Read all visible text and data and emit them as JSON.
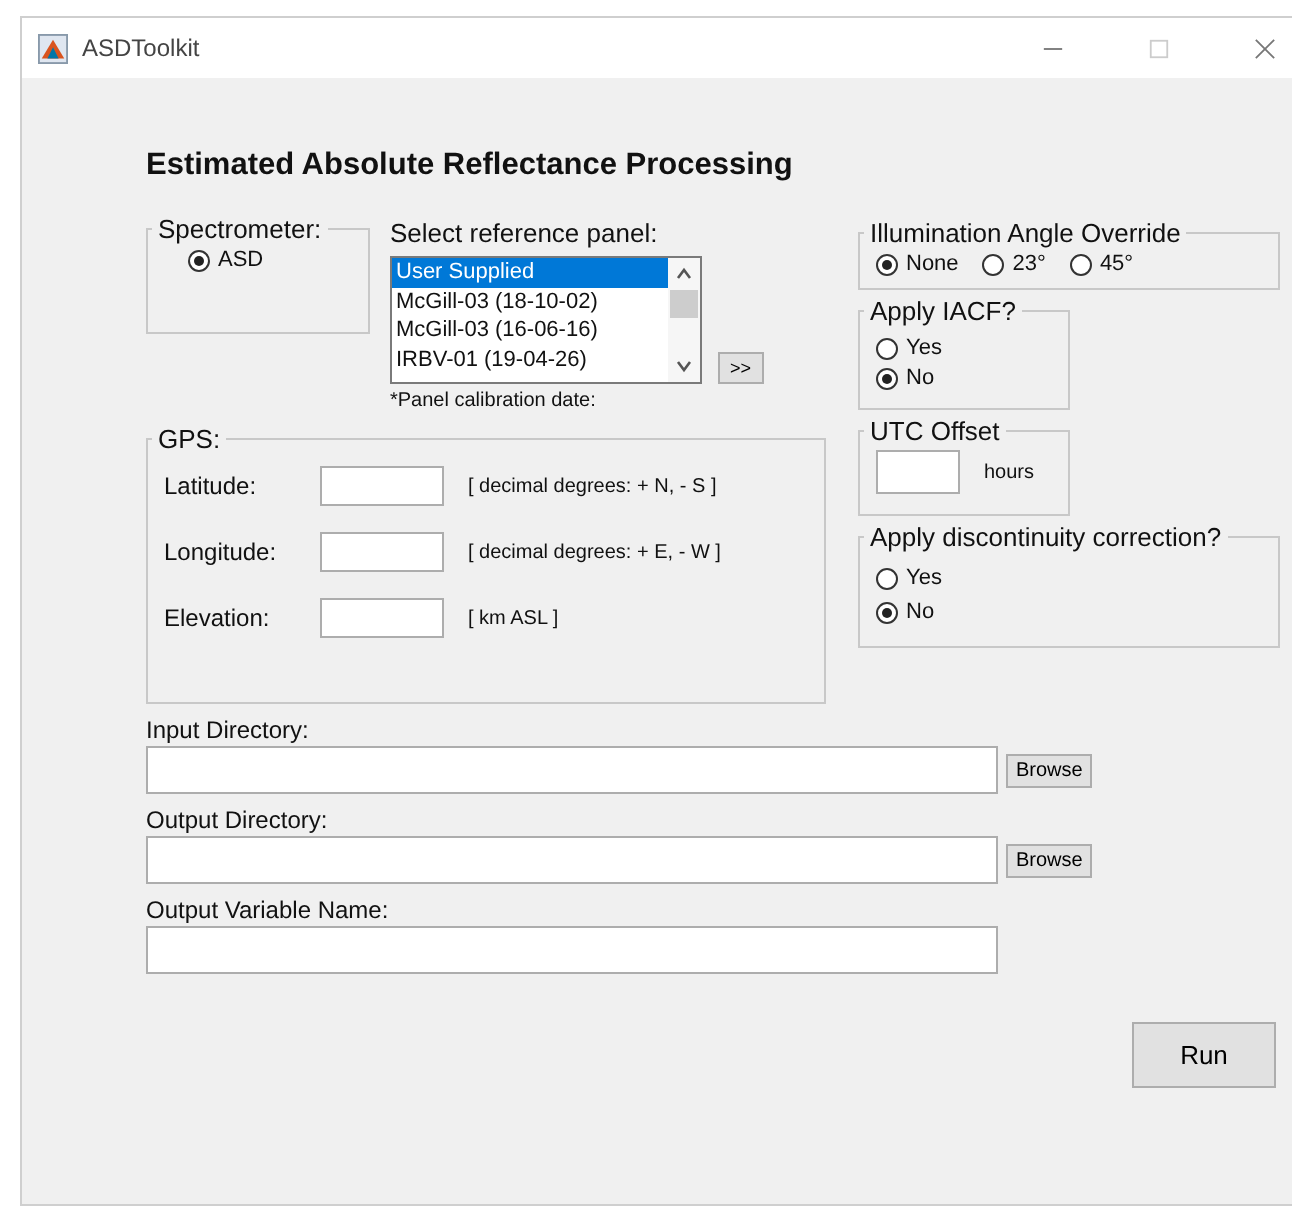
{
  "window": {
    "title": "ASDToolkit"
  },
  "heading": "Estimated Absolute Reflectance Processing",
  "spectrometer": {
    "label": "Spectrometer:",
    "options": [
      {
        "label": "ASD",
        "selected": true
      }
    ]
  },
  "reference_panel": {
    "label": "Select reference panel:",
    "items": [
      {
        "label": "User Supplied",
        "selected": true
      },
      {
        "label": "McGill-03 (18-10-02)",
        "selected": false
      },
      {
        "label": "McGill-03 (16-06-16)",
        "selected": false
      },
      {
        "label": "IRBV-01 (19-04-26)",
        "selected": false
      }
    ],
    "add_button": ">>",
    "note": "*Panel calibration date:"
  },
  "gps": {
    "label": "GPS:",
    "fields": [
      {
        "label": "Latitude:",
        "hint": "[ decimal degrees: + N, - S ]"
      },
      {
        "label": "Longitude:",
        "hint": "[ decimal degrees: + E, - W ]"
      },
      {
        "label": "Elevation:",
        "hint": "[ km ASL ]"
      }
    ]
  },
  "illumination": {
    "label": "Illumination Angle Override",
    "options": [
      {
        "label": "None",
        "selected": true
      },
      {
        "label": "23°",
        "selected": false
      },
      {
        "label": "45°",
        "selected": false
      }
    ]
  },
  "iacf": {
    "label": "Apply IACF?",
    "options": [
      {
        "label": "Yes",
        "selected": false
      },
      {
        "label": "No",
        "selected": true
      }
    ]
  },
  "utc": {
    "label": "UTC Offset",
    "unit": "hours"
  },
  "discontinuity": {
    "label": "Apply discontinuity correction?",
    "options": [
      {
        "label": "Yes",
        "selected": false
      },
      {
        "label": "No",
        "selected": true
      }
    ]
  },
  "paths": [
    {
      "label": "Input Directory:",
      "button": "Browse"
    },
    {
      "label": "Output Directory:",
      "button": "Browse"
    },
    {
      "label": "Output Variable Name:"
    }
  ],
  "run_button": "Run"
}
